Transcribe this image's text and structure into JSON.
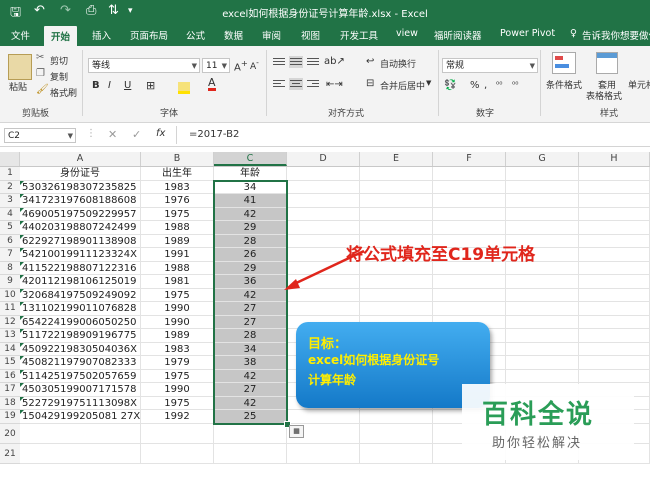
{
  "window": {
    "title": "excel如何根据身份证号计算年龄.xlsx - Excel"
  },
  "tabs": [
    "文件",
    "开始",
    "插入",
    "页面布局",
    "公式",
    "数据",
    "审阅",
    "视图",
    "开发工具",
    "view",
    "福昕阅读器",
    "Power Pivot"
  ],
  "tell_me": "告诉我你想要做什",
  "ribbon": {
    "clipboard": {
      "paste": "粘贴",
      "cut": "剪切",
      "copy": "复制",
      "format_painter": "格式刷",
      "label": "剪贴板"
    },
    "font": {
      "name": "等线",
      "size": "11",
      "label": "字体",
      "bold": "B",
      "italic": "I",
      "underline": "U"
    },
    "alignment": {
      "wrap": "自动换行",
      "merge": "合并后居中",
      "label": "对齐方式"
    },
    "number": {
      "format": "常规",
      "label": "数字",
      "percent": "%",
      "comma": ","
    },
    "styles": {
      "conditional": "条件格式",
      "table1": "套用",
      "table2": "表格格式",
      "cell": "单元格",
      "label": "样式"
    }
  },
  "formula_bar": {
    "name_box": "C2",
    "formula": "=2017-B2",
    "fx": "fx"
  },
  "columns": [
    "A",
    "B",
    "C",
    "D",
    "E",
    "F",
    "G",
    "H"
  ],
  "headers": {
    "a": "身份证号",
    "b": "出生年",
    "c": "年龄"
  },
  "rows": [
    {
      "id": "530326198307235825",
      "year": "1983",
      "age": "34"
    },
    {
      "id": "341723197608188608",
      "year": "1976",
      "age": "41"
    },
    {
      "id": "469005197509229957",
      "year": "1975",
      "age": "42"
    },
    {
      "id": "440203198807242499",
      "year": "1988",
      "age": "29"
    },
    {
      "id": "622927198901138908",
      "year": "1989",
      "age": "28"
    },
    {
      "id": "54210019911123324X",
      "year": "1991",
      "age": "26"
    },
    {
      "id": "411522198807122316",
      "year": "1988",
      "age": "29"
    },
    {
      "id": "420112198106125019",
      "year": "1981",
      "age": "36"
    },
    {
      "id": "320684197509249092",
      "year": "1975",
      "age": "42"
    },
    {
      "id": "131102199011076828",
      "year": "1990",
      "age": "27"
    },
    {
      "id": "654224199006050250",
      "year": "1990",
      "age": "27"
    },
    {
      "id": "511722198909196775",
      "year": "1989",
      "age": "28"
    },
    {
      "id": "45092219830504036X",
      "year": "1983",
      "age": "34"
    },
    {
      "id": "450821197907082333",
      "year": "1979",
      "age": "38"
    },
    {
      "id": "511425197502057659",
      "year": "1975",
      "age": "42"
    },
    {
      "id": "450305199007171578",
      "year": "1990",
      "age": "27"
    },
    {
      "id": "52272919751113098X",
      "year": "1975",
      "age": "42"
    },
    {
      "id": "150429199205081 27X",
      "year": "1992",
      "age": "25"
    }
  ],
  "extra_row_numbers": [
    "20",
    "21"
  ],
  "annotation": {
    "arrow_text": "将公式填充至C19单元格",
    "callout_title": "目标：",
    "callout_line1": "excel如何根据身份证号",
    "callout_line2": "计算年龄",
    "color_red": "#e0261c",
    "color_blue": "#1a8fd8"
  },
  "watermark": {
    "title": "百科全说",
    "subtitle": "助你轻松解决"
  }
}
